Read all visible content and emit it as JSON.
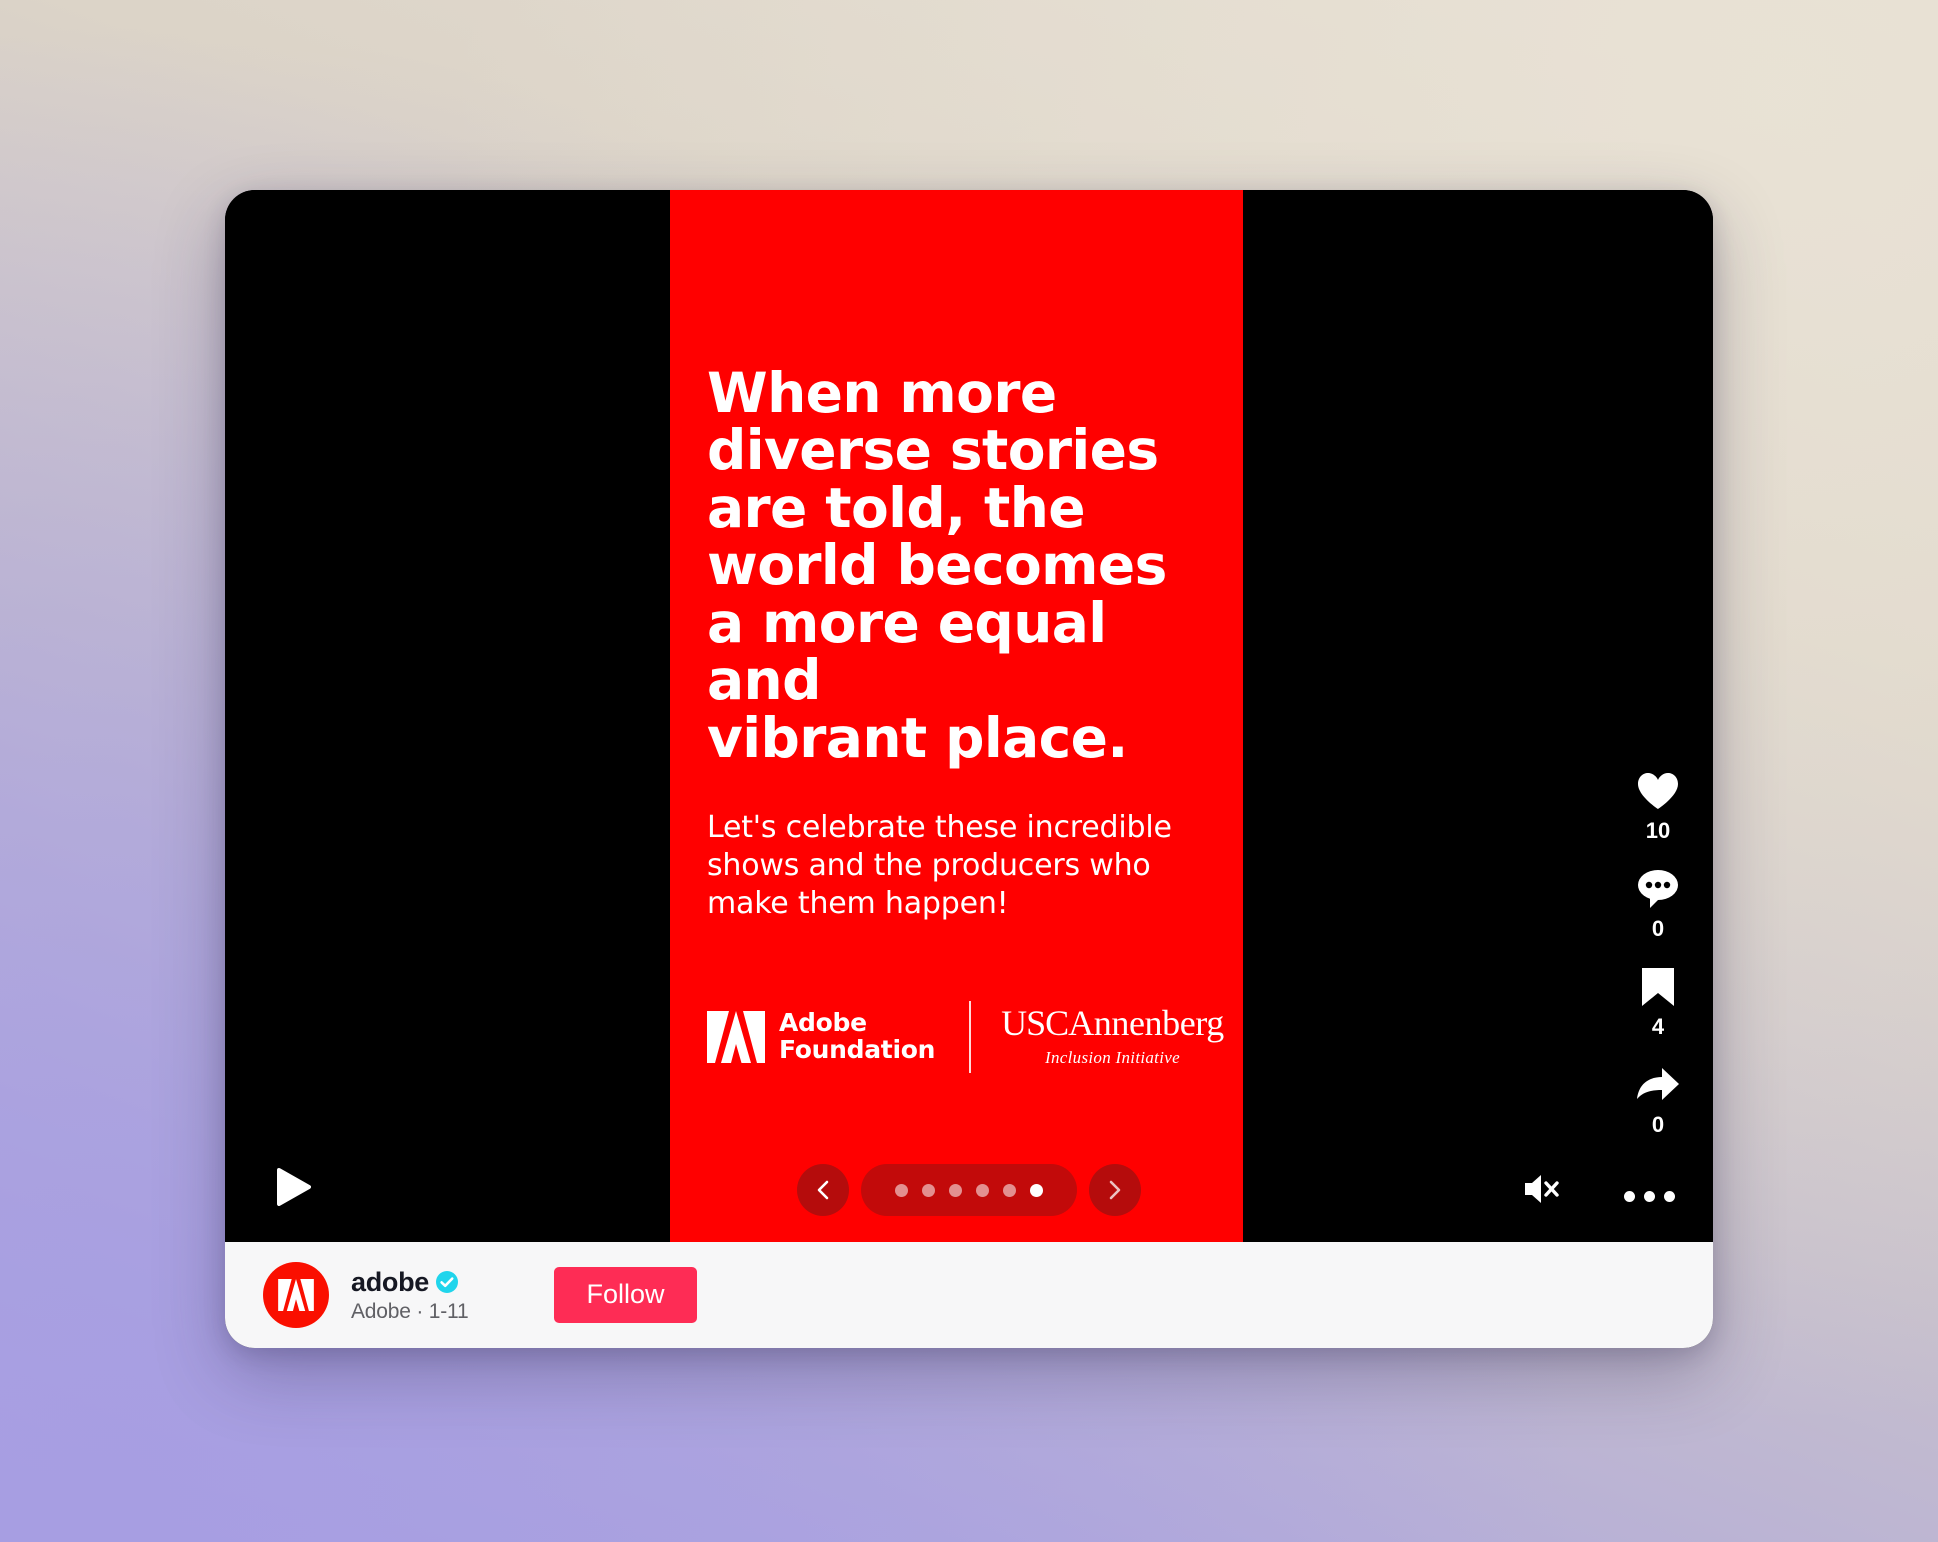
{
  "slide": {
    "headline": "When more\ndiverse stories\nare told, the\nworld becomes\na more equal and\nvibrant place.",
    "subline": "Let's celebrate these incredible\nshows and the producers who\nmake them happen!",
    "background_color": "#ff0000",
    "text_color": "#ffffff"
  },
  "logos": {
    "adobe": {
      "line1": "Adobe",
      "line2": "Foundation",
      "mark_name": "adobe-a-mark"
    },
    "usc": {
      "caps": "USC",
      "rest": "Annenberg",
      "subtitle": "Inclusion Initiative"
    }
  },
  "actions": [
    {
      "name": "like",
      "icon": "heart-icon",
      "count": "10"
    },
    {
      "name": "comment",
      "icon": "comment-icon",
      "count": "0"
    },
    {
      "name": "bookmark",
      "icon": "bookmark-icon",
      "count": "4"
    },
    {
      "name": "share",
      "icon": "share-arrow-icon",
      "count": "0"
    }
  ],
  "carousel": {
    "prev_label": "Previous slide",
    "next_label": "Next slide",
    "total": 6,
    "active_index": 5
  },
  "player": {
    "play_label": "Play",
    "mute_label": "Unmute",
    "more_label": "More options",
    "muted": true
  },
  "profile": {
    "handle": "adobe",
    "verified": true,
    "display_name": "Adobe",
    "separator": "·",
    "date": "1-11",
    "subtitle": "Adobe · 1-11",
    "follow_label": "Follow",
    "follow_color": "#fe2c55",
    "avatar_color": "#fa0f00",
    "verified_color": "#20d5ec"
  }
}
